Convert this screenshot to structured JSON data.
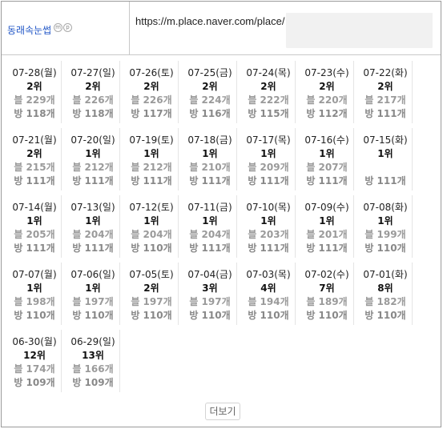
{
  "header": {
    "keyword": "동래속눈썹",
    "badges": [
      "m",
      "p"
    ],
    "url": "https://m.place.naver.com/place/"
  },
  "entries": [
    {
      "date": "07-28(월)",
      "rank": "2위",
      "blog": "블 229개",
      "bang": "방 118개"
    },
    {
      "date": "07-27(일)",
      "rank": "2위",
      "blog": "블 226개",
      "bang": "방 118개"
    },
    {
      "date": "07-26(토)",
      "rank": "2위",
      "blog": "블 226개",
      "bang": "방 117개"
    },
    {
      "date": "07-25(금)",
      "rank": "2위",
      "blog": "블 224개",
      "bang": "방 116개"
    },
    {
      "date": "07-24(목)",
      "rank": "2위",
      "blog": "블 222개",
      "bang": "방 115개"
    },
    {
      "date": "07-23(수)",
      "rank": "2위",
      "blog": "블 220개",
      "bang": "방 112개"
    },
    {
      "date": "07-22(화)",
      "rank": "2위",
      "blog": "블 217개",
      "bang": "방 111개"
    },
    {
      "date": "07-21(월)",
      "rank": "2위",
      "blog": "블 215개",
      "bang": "방 111개"
    },
    {
      "date": "07-20(일)",
      "rank": "1위",
      "blog": "블 212개",
      "bang": "방 111개"
    },
    {
      "date": "07-19(토)",
      "rank": "1위",
      "blog": "블 212개",
      "bang": "방 111개"
    },
    {
      "date": "07-18(금)",
      "rank": "1위",
      "blog": "블 210개",
      "bang": "방 111개"
    },
    {
      "date": "07-17(목)",
      "rank": "1위",
      "blog": "블 209개",
      "bang": "방 111개"
    },
    {
      "date": "07-16(수)",
      "rank": "1위",
      "blog": "블 207개",
      "bang": "방 111개"
    },
    {
      "date": "07-15(화)",
      "rank": "1위",
      "blog": "",
      "bang": "방 111개"
    },
    {
      "date": "07-14(월)",
      "rank": "1위",
      "blog": "블 205개",
      "bang": "방 111개"
    },
    {
      "date": "07-13(일)",
      "rank": "1위",
      "blog": "블 204개",
      "bang": "방 111개"
    },
    {
      "date": "07-12(토)",
      "rank": "1위",
      "blog": "블 204개",
      "bang": "방 110개"
    },
    {
      "date": "07-11(금)",
      "rank": "1위",
      "blog": "블 204개",
      "bang": "방 111개"
    },
    {
      "date": "07-10(목)",
      "rank": "1위",
      "blog": "블 203개",
      "bang": "방 111개"
    },
    {
      "date": "07-09(수)",
      "rank": "1위",
      "blog": "블 201개",
      "bang": "방 111개"
    },
    {
      "date": "07-08(화)",
      "rank": "1위",
      "blog": "블 199개",
      "bang": "방 110개"
    },
    {
      "date": "07-07(월)",
      "rank": "1위",
      "blog": "블 198개",
      "bang": "방 110개"
    },
    {
      "date": "07-06(일)",
      "rank": "1위",
      "blog": "블 197개",
      "bang": "방 110개"
    },
    {
      "date": "07-05(토)",
      "rank": "2위",
      "blog": "블 197개",
      "bang": "방 110개"
    },
    {
      "date": "07-04(금)",
      "rank": "3위",
      "blog": "블 197개",
      "bang": "방 110개"
    },
    {
      "date": "07-03(목)",
      "rank": "4위",
      "blog": "블 194개",
      "bang": "방 110개"
    },
    {
      "date": "07-02(수)",
      "rank": "7위",
      "blog": "블 189개",
      "bang": "방 110개"
    },
    {
      "date": "07-01(화)",
      "rank": "8위",
      "blog": "블 182개",
      "bang": "방 110개"
    },
    {
      "date": "06-30(월)",
      "rank": "12위",
      "blog": "블 174개",
      "bang": "방 109개"
    },
    {
      "date": "06-29(일)",
      "rank": "13위",
      "blog": "블 166개",
      "bang": "방 109개"
    }
  ],
  "more_label": "더보기",
  "colors": {
    "keyword_link": "#2257c7",
    "rank_text": "#111111",
    "count_text": "#9a9a9a",
    "border": "#9a9a9a"
  }
}
